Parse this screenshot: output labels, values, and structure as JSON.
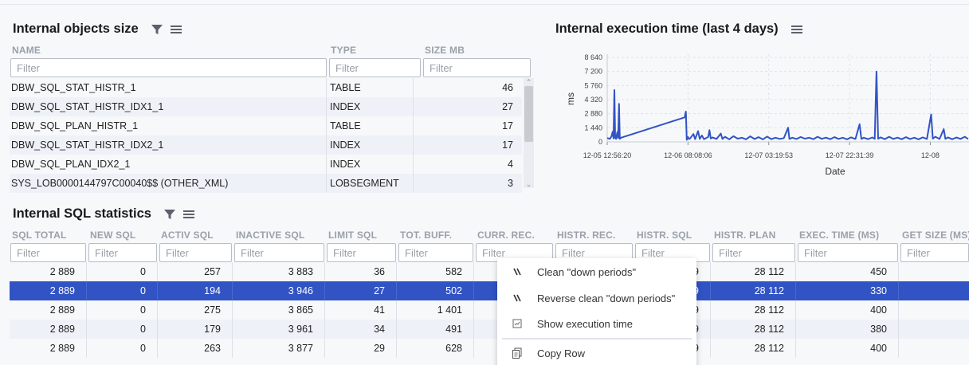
{
  "objects_panel": {
    "title": "Internal objects size",
    "columns": [
      "NAME",
      "TYPE",
      "SIZE MB"
    ],
    "filter_placeholder": "Filter",
    "rows": [
      {
        "name": "DBW_SQL_STAT_HISTR_1",
        "type": "TABLE",
        "size": "46"
      },
      {
        "name": "DBW_SQL_STAT_HISTR_IDX1_1",
        "type": "INDEX",
        "size": "27"
      },
      {
        "name": "DBW_SQL_PLAN_HISTR_1",
        "type": "TABLE",
        "size": "17"
      },
      {
        "name": "DBW_SQL_STAT_HISTR_IDX2_1",
        "type": "INDEX",
        "size": "17"
      },
      {
        "name": "DBW_SQL_PLAN_IDX2_1",
        "type": "INDEX",
        "size": "4"
      },
      {
        "name": "SYS_LOB0000144797C00040$$ (OTHER_XML)",
        "type": "LOBSEGMENT",
        "size": "3"
      }
    ]
  },
  "exec_panel": {
    "title": "Internal execution time (last 4 days)"
  },
  "chart_data": {
    "type": "line",
    "ylabel": "ms",
    "xlabel": "Date",
    "y_ticks": [
      "8 640",
      "7 200",
      "5 760",
      "4 320",
      "2 880",
      "1 440",
      "0"
    ],
    "y_tick_values": [
      8640,
      7200,
      5760,
      4320,
      2880,
      1440,
      0
    ],
    "ylim": [
      0,
      8640
    ],
    "x_ticks": [
      "12-05 12:56:20",
      "12-06 08:08:06",
      "12-07 03:19:53",
      "12-07 22:31:39",
      "12-08"
    ],
    "grid": true,
    "series": [
      {
        "color": "#3153c4",
        "points": [
          [
            0.0,
            400
          ],
          [
            0.6,
            300
          ],
          [
            1.0,
            550
          ],
          [
            1.3,
            1050
          ],
          [
            1.5,
            350
          ],
          [
            1.7,
            5300
          ],
          [
            1.9,
            400
          ],
          [
            2.1,
            300
          ],
          [
            2.4,
            1000
          ],
          [
            2.6,
            380
          ],
          [
            2.8,
            3900
          ],
          [
            3.0,
            300
          ],
          [
            3.3,
            420
          ],
          [
            18.4,
            2500
          ],
          [
            18.7,
            3100
          ],
          [
            18.9,
            200
          ],
          [
            19.2,
            500
          ],
          [
            19.4,
            300
          ],
          [
            19.7,
            350
          ],
          [
            20.5,
            800
          ],
          [
            20.9,
            280
          ],
          [
            21.6,
            1100
          ],
          [
            22.0,
            300
          ],
          [
            22.5,
            650
          ],
          [
            23.0,
            280
          ],
          [
            24.0,
            500
          ],
          [
            24.3,
            1200
          ],
          [
            24.6,
            350
          ],
          [
            25.0,
            450
          ],
          [
            26.0,
            300
          ],
          [
            27.0,
            850
          ],
          [
            27.4,
            300
          ],
          [
            28.0,
            520
          ],
          [
            29.0,
            260
          ],
          [
            30.0,
            580
          ],
          [
            31.0,
            330
          ],
          [
            32.0,
            420
          ],
          [
            33.0,
            260
          ],
          [
            34.0,
            560
          ],
          [
            35.0,
            290
          ],
          [
            36.0,
            480
          ],
          [
            37.0,
            250
          ],
          [
            38.0,
            540
          ],
          [
            39.0,
            280
          ],
          [
            40.0,
            420
          ],
          [
            41.0,
            300
          ],
          [
            42.0,
            380
          ],
          [
            43.0,
            1450
          ],
          [
            43.3,
            300
          ],
          [
            44.0,
            420
          ],
          [
            45.0,
            290
          ],
          [
            46.0,
            500
          ],
          [
            47.0,
            330
          ],
          [
            48.0,
            420
          ],
          [
            49.0,
            280
          ],
          [
            50.0,
            520
          ],
          [
            51.0,
            310
          ],
          [
            52.0,
            430
          ],
          [
            53.0,
            280
          ],
          [
            54.0,
            480
          ],
          [
            55.0,
            300
          ],
          [
            56.0,
            420
          ],
          [
            57.0,
            260
          ],
          [
            58.0,
            460
          ],
          [
            59.0,
            290
          ],
          [
            60.0,
            1800
          ],
          [
            60.4,
            300
          ],
          [
            61.0,
            420
          ],
          [
            62.0,
            280
          ],
          [
            63.0,
            450
          ],
          [
            63.6,
            300
          ],
          [
            64.0,
            7200
          ],
          [
            64.4,
            320
          ],
          [
            65.0,
            460
          ],
          [
            66.0,
            280
          ],
          [
            67.0,
            520
          ],
          [
            68.0,
            300
          ],
          [
            69.0,
            430
          ],
          [
            70.0,
            270
          ],
          [
            71.0,
            480
          ],
          [
            72.0,
            290
          ],
          [
            73.0,
            420
          ],
          [
            74.0,
            260
          ],
          [
            75.0,
            460
          ],
          [
            76.0,
            300
          ],
          [
            77.0,
            2800
          ],
          [
            77.4,
            330
          ],
          [
            78.0,
            520
          ],
          [
            79.0,
            290
          ],
          [
            80.0,
            1300
          ],
          [
            80.4,
            300
          ],
          [
            81.0,
            460
          ],
          [
            82.0,
            270
          ],
          [
            83.0,
            450
          ],
          [
            84.0,
            300
          ],
          [
            85.0,
            520
          ],
          [
            85.8,
            290
          ]
        ],
        "x_unit": "hours since 12-05 12:56:20"
      }
    ]
  },
  "sql_panel": {
    "title": "Internal SQL statistics",
    "columns": [
      "SQL TOTAL",
      "NEW SQL",
      "ACTIV SQL",
      "INACTIVE SQL",
      "LIMIT SQL",
      "TOT. BUFF.",
      "CURR. REC.",
      "HISTR. REC.",
      "HISTR. SQL",
      "HISTR. PLAN",
      "EXEC. TIME (MS)",
      "GET SIZE (MS)"
    ],
    "filter_placeholder": "Filter",
    "rows": [
      {
        "cells": [
          "2 889",
          "0",
          "257",
          "3 883",
          "36",
          "582",
          "",
          "",
          "99",
          "28 112",
          "450"
        ]
      },
      {
        "cells": [
          "2 889",
          "0",
          "194",
          "3 946",
          "27",
          "502",
          "",
          "",
          "99",
          "28 112",
          "330"
        ]
      },
      {
        "cells": [
          "2 889",
          "0",
          "275",
          "3 865",
          "41",
          "1 401",
          "",
          "",
          "99",
          "28 112",
          "400"
        ]
      },
      {
        "cells": [
          "2 889",
          "0",
          "179",
          "3 961",
          "34",
          "491",
          "",
          "",
          "99",
          "28 112",
          "380"
        ]
      },
      {
        "cells": [
          "2 889",
          "0",
          "263",
          "3 877",
          "29",
          "628",
          "",
          "",
          "99",
          "28 112",
          "400"
        ]
      }
    ],
    "selected_row": 1
  },
  "context_menu": {
    "items": [
      {
        "label": "Clean \"down periods\"",
        "icon": "clean-icon"
      },
      {
        "label": "Reverse clean \"down periods\"",
        "icon": "reverse-clean-icon"
      },
      {
        "label": "Show execution time",
        "icon": "chart-icon"
      },
      {
        "label": "Copy Row",
        "icon": "copy-icon"
      }
    ]
  },
  "colors": {
    "accent": "#3153c4",
    "row_alt": "#eef1f7",
    "header_text": "#9aa1ab"
  }
}
